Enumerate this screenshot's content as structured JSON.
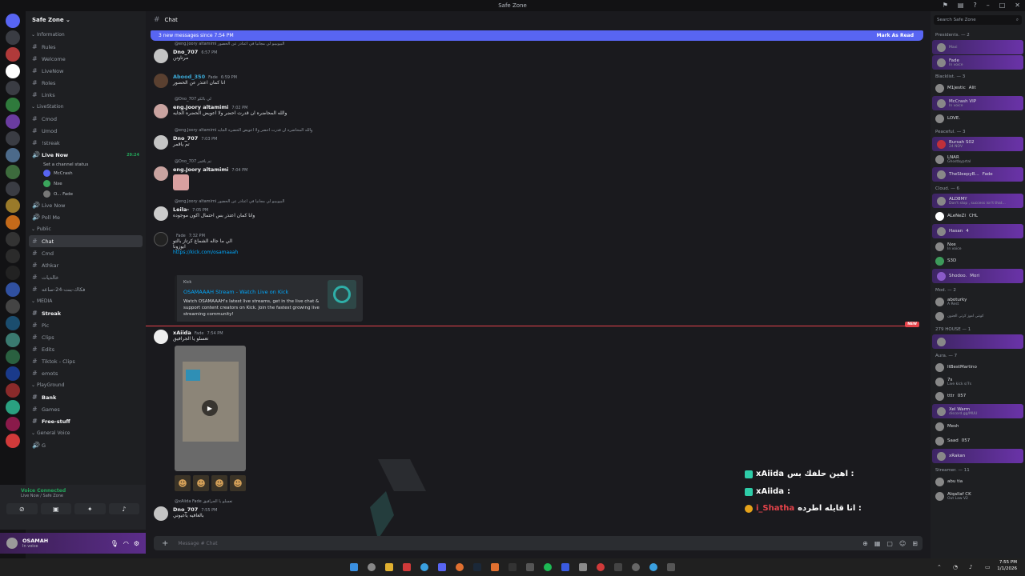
{
  "window": {
    "title": "Safe Zone"
  },
  "server": {
    "name": "Safe Zone"
  },
  "sidebar": {
    "categories": [
      {
        "label": "Information",
        "channels": [
          "Rules",
          "Welcome",
          "LiveNow",
          "Roles",
          "Links"
        ]
      },
      {
        "label": "LiveStation",
        "channels": [
          "Cmod",
          "Umod",
          "!streak"
        ]
      },
      {
        "label": "Public",
        "channels": [
          "Chat",
          "Cmd",
          "Athkar",
          "خالديات",
          "فكاك-بنت-24-ساعه"
        ]
      },
      {
        "label": "MEDIA",
        "channels": [
          "Streak",
          "Pic",
          "Clips",
          "Edits",
          "Tiktok - Clips",
          "emots"
        ]
      },
      {
        "label": "PlayGround",
        "channels": [
          "Bank",
          "Games",
          "Free-stuff"
        ]
      },
      {
        "label": "General Voice",
        "channels": [
          "G"
        ]
      }
    ],
    "voice_live": {
      "name": "Live Now",
      "status": "Set a channel status",
      "timer": "29:24",
      "users": [
        "McCrash",
        "Nxe",
        "O...  Fade"
      ]
    },
    "voice_channels": [
      "Live Now",
      "Poll Me"
    ],
    "active_channel": "Chat"
  },
  "voice_panel": {
    "status": "Voice Connected",
    "location": "Live Now / Safe Zone"
  },
  "user": {
    "name": "OSAMAH",
    "status": "In voice"
  },
  "channel": {
    "name": "Chat",
    "new_messages": "3 new messages since 7:54 PM",
    "mark_read": "Mark As Read"
  },
  "messages": [
    {
      "reply": "@eng.Joory altamimi البيوبيبو لي مجانيا في اعتاذر عن الحضور",
      "author": "Dno_707",
      "time": "6:57 PM",
      "text": "مرتاوتن"
    },
    {
      "reply": "",
      "author": "Abood_350",
      "tag": "Fade",
      "time": "6:59 PM",
      "text": "انا كمان اعتذر عن الحضور"
    },
    {
      "reply": "@Dno_707 لي بالكو",
      "author": "eng.Joory altamimi",
      "time": "7:02 PM",
      "text": "والله المحاضره ان قدرت احضر ولا اعويض الحضره الجايه"
    },
    {
      "reply": "@eng.Joory altamimi والله المحاضره ان قدرت احضر ولا اعويض الحضره الجايه",
      "author": "Dno_707",
      "time": "7:03 PM",
      "text": "تم ياقمر"
    },
    {
      "reply": "@Dno_707 تم ياقمر",
      "author": "eng.Joory altamimi",
      "time": "7:04 PM",
      "text": ""
    },
    {
      "reply": "@eng.Joory altamimi البيوبيبو لي مجانيا في اعتاذر عن الحضور",
      "author": "Leila-",
      "time": "7:05 PM",
      "text": "وانا كمان اعتذر بس احتمال اكون موجوده"
    },
    {
      "reply": "",
      "author": "",
      "tag": "Fade",
      "time": "7:32 PM",
      "text": "الي ما جاله الشماغ كرتاز بالتو",
      "text2": "ابوزونا",
      "link": "https://kick.com/osamaaah"
    },
    {
      "reply": "",
      "author": "xAiida",
      "tag": "Fade",
      "time": "7:54 PM",
      "text": "تعسلو يا الجرافيق"
    },
    {
      "reply": "@xAiida  Fade  تعسلو يا الجرافيق",
      "author": "Dno_707",
      "time": "7:55 PM",
      "text": "بالعافيه ياعيوني"
    }
  ],
  "embed": {
    "provider": "Kick",
    "title": "OSAMAAAH Stream - Watch Live on Kick",
    "description": "Watch OSAMAAAH's latest live streams, get in the live chat & support content creators on Kick. Join the fastest growing live streaming community!"
  },
  "new_marker": "NEW",
  "composer": {
    "placeholder": "Message # Chat"
  },
  "overlay": [
    {
      "user": "xAiida",
      "text": "اهين حلفك بس :"
    },
    {
      "user": "xAiida",
      "text": ":"
    },
    {
      "user": "i_Shatha",
      "text": "انا قايله اطرده :"
    }
  ],
  "members": {
    "search_placeholder": "Search Safe Zone",
    "groups": [
      {
        "label": "Presidents. — 2",
        "items": [
          {
            "name": "",
            "sub": "Maxi"
          },
          {
            "name": "",
            "sub": "In voice",
            "tag": "Fade"
          }
        ]
      },
      {
        "label": "Blacklist. — 3",
        "items": [
          {
            "name": "M1jestic",
            "sub": "",
            "tag": "Alit"
          },
          {
            "name": "McCrash",
            "sub": "In voice",
            "tag": "VIP"
          },
          {
            "name": "LOVE.",
            "sub": ""
          }
        ]
      },
      {
        "label": "Peaceful. — 3",
        "items": [
          {
            "name": "Bursah",
            "sub": "24 NOV",
            "tag": "S02"
          },
          {
            "name": "LNAR",
            "sub": "Ghostbyprtal"
          },
          {
            "name": "TheSleepyB...",
            "sub": "",
            "tag": "Fade"
          }
        ]
      },
      {
        "label": "Cloud. — 6",
        "items": [
          {
            "name": "ALD8MY",
            "sub": "Don't stop , success isn't that..."
          },
          {
            "name": "ALeNeZI",
            "sub": "",
            "tag": "CHL"
          },
          {
            "name": "Hasan",
            "sub": "",
            "tag": "4"
          },
          {
            "name": "Nxe",
            "sub": "In voice"
          },
          {
            "name": "S3D",
            "sub": ""
          },
          {
            "name": "Shodoo.",
            "sub": "",
            "tag": "Mori"
          }
        ]
      },
      {
        "label": "Mod. — 2",
        "items": [
          {
            "name": "aboturky",
            "sub": "A Rest"
          },
          {
            "name": "",
            "sub": "كونتي اموز كرتي الجنون"
          }
        ]
      },
      {
        "label": "279 HOUSE — 1",
        "items": [
          {
            "name": "",
            "sub": ""
          }
        ]
      },
      {
        "label": "Aura. — 7",
        "items": [
          {
            "name": "ItBestMartino",
            "sub": ""
          },
          {
            "name": "7s",
            "sub": "Live kick s/7s"
          },
          {
            "name": "tttr",
            "sub": "",
            "tag": "057"
          },
          {
            "name": "Xel",
            "sub": "discord.gg/MUU",
            "tag": "Warm"
          },
          {
            "name": "Mesh",
            "sub": ""
          },
          {
            "name": "Saad",
            "sub": "",
            "tag": "057"
          },
          {
            "name": "xRakan",
            "sub": ""
          }
        ]
      },
      {
        "label": "Streamer. — 11",
        "items": [
          {
            "name": "abu tia",
            "sub": ""
          },
          {
            "name": "Alqallaf",
            "sub": "Out Law V2",
            "tag": "CK"
          }
        ]
      }
    ]
  },
  "clock": {
    "time": "7:55 PM",
    "date": "1/1/2026"
  },
  "colors": {
    "accent": "#5865f2",
    "bg": "#1a1a1e",
    "new_marker": "#e5434a",
    "voice": "#23a55a"
  }
}
